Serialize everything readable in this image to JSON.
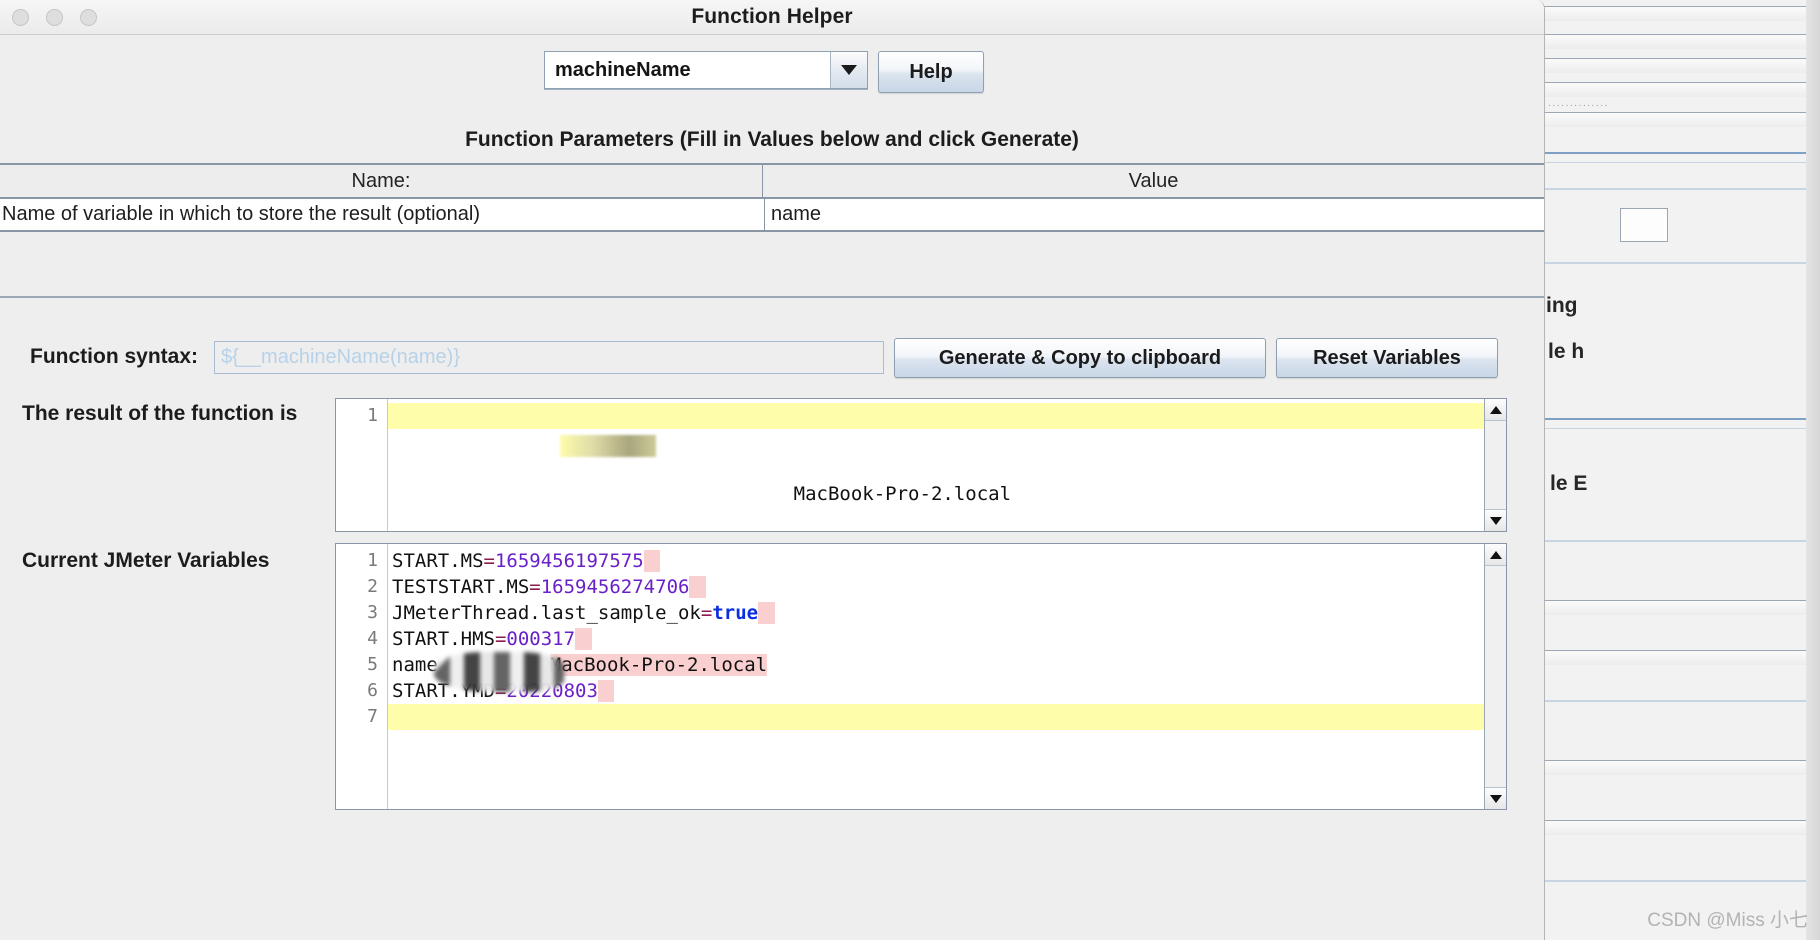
{
  "window": {
    "title": "Function Helper",
    "traffic_lights": [
      "close",
      "minimize",
      "zoom"
    ]
  },
  "toolbar": {
    "function_selected": "machineName",
    "dropdown_icon": "chevron-down-icon",
    "help_label": "Help"
  },
  "parameters": {
    "section_title": "Function Parameters (Fill in Values below and click Generate)",
    "columns": [
      "Name:",
      "Value"
    ],
    "rows": [
      {
        "name": "Name of variable in which to store the result (optional)",
        "value": "name"
      }
    ]
  },
  "syntax": {
    "label": "Function syntax:",
    "value": "${__machineName(name)}",
    "generate_label": "Generate & Copy to clipboard",
    "reset_label": "Reset Variables"
  },
  "result": {
    "label": "The result of the function is",
    "lines": [
      {
        "no": "1",
        "redacted": true,
        "text": "MacBook-Pro-2.local",
        "highlight": true
      }
    ]
  },
  "variables": {
    "label": "Current JMeter Variables",
    "lines": [
      {
        "no": "1",
        "key": "START.MS",
        "value": "1659456197575",
        "type": "number"
      },
      {
        "no": "2",
        "key": "TESTSTART.MS",
        "value": "1659456274706",
        "type": "number"
      },
      {
        "no": "3",
        "key": "JMeterThread.last_sample_ok",
        "value": "true",
        "type": "bool"
      },
      {
        "no": "4",
        "key": "START.HMS",
        "value": "000317",
        "type": "number"
      },
      {
        "no": "5",
        "key": "name",
        "value": "MacBook-Pro-2.local",
        "type": "redacted"
      },
      {
        "no": "6",
        "key": "START.YMD",
        "value": "20220803",
        "type": "number"
      },
      {
        "no": "7",
        "key": "",
        "value": "",
        "type": "empty"
      }
    ]
  },
  "scrollbars": {
    "up_icon": "triangle-up-icon",
    "down_icon": "triangle-down-icon"
  },
  "background_window": {
    "fragments": [
      "ing",
      "le h",
      "le E"
    ]
  },
  "watermark": "CSDN @Miss 小七",
  "colors": {
    "window_bg": "#eeeeee",
    "highlight_yellow": "#fdfdaa",
    "mark_pink": "#f9cfcf",
    "number_purple": "#6a20c8",
    "bool_blue": "#0b2ee0",
    "placeholder_blue": "#b7d2e8"
  }
}
